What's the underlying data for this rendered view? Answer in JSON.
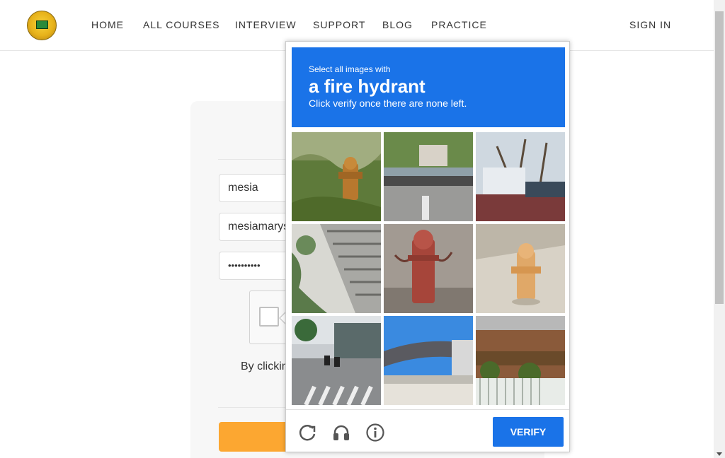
{
  "nav": {
    "links": [
      "HOME",
      "ALL COURSES",
      "INTERVIEW",
      "SUPPORT",
      "BLOG",
      "PRACTICE"
    ],
    "sign_in": "SIGN IN"
  },
  "form": {
    "name_value": "mesia",
    "email_value": "mesiamarys",
    "password_value": "••••••••••",
    "terms_prefix": "By clickin"
  },
  "captcha": {
    "prompt_line1": "Select all images with",
    "prompt_object": "a fire hydrant",
    "prompt_line3": "Click verify once there are none left.",
    "tiles": [
      "hydrant-in-grass",
      "bridge-road",
      "house-trees",
      "stairs-plants",
      "red-hydrant",
      "yellow-hydrant",
      "street-scooters",
      "overpass",
      "building-fence"
    ],
    "icons": [
      "reload-icon",
      "audio-icon",
      "info-icon"
    ],
    "verify_label": "VERIFY",
    "accent_color": "#1a73e8"
  }
}
